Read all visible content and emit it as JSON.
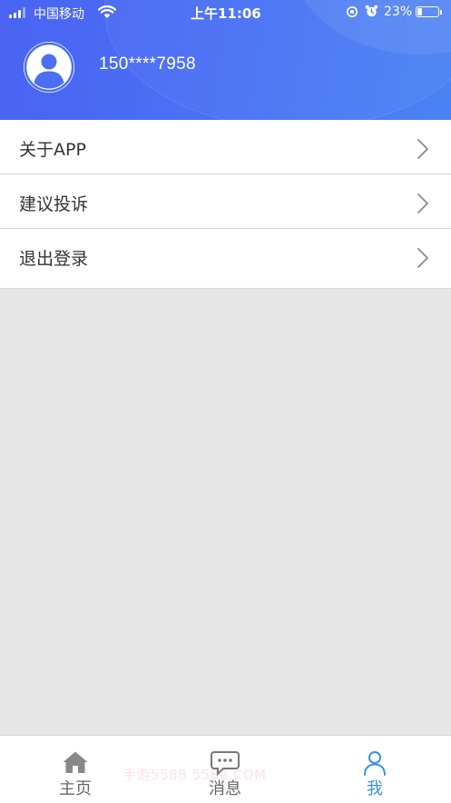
{
  "status_bar": {
    "carrier": "中国移动",
    "time": "上午11:06",
    "battery_percent": "23%",
    "battery_level": 0.23
  },
  "profile": {
    "avatar_icon": "user-avatar-icon",
    "phone": "150****7958"
  },
  "menu": {
    "items": [
      {
        "label": "关于APP",
        "icon": "chevron-right-icon"
      },
      {
        "label": "建议投诉",
        "icon": "chevron-right-icon"
      },
      {
        "label": "退出登录",
        "icon": "chevron-right-icon"
      }
    ]
  },
  "tabbar": {
    "tabs": [
      {
        "label": "主页",
        "icon": "home-icon",
        "active": false
      },
      {
        "label": "消息",
        "icon": "message-icon",
        "active": false
      },
      {
        "label": "我",
        "icon": "person-icon",
        "active": true
      }
    ]
  },
  "watermark": "手游5588 5588.COM",
  "colors": {
    "header_gradient_start": "#4a63f2",
    "header_gradient_end": "#4b83f2",
    "active_tab": "#3a8ee6",
    "inactive_tab": "#666666",
    "page_background": "#e6e6e6"
  }
}
